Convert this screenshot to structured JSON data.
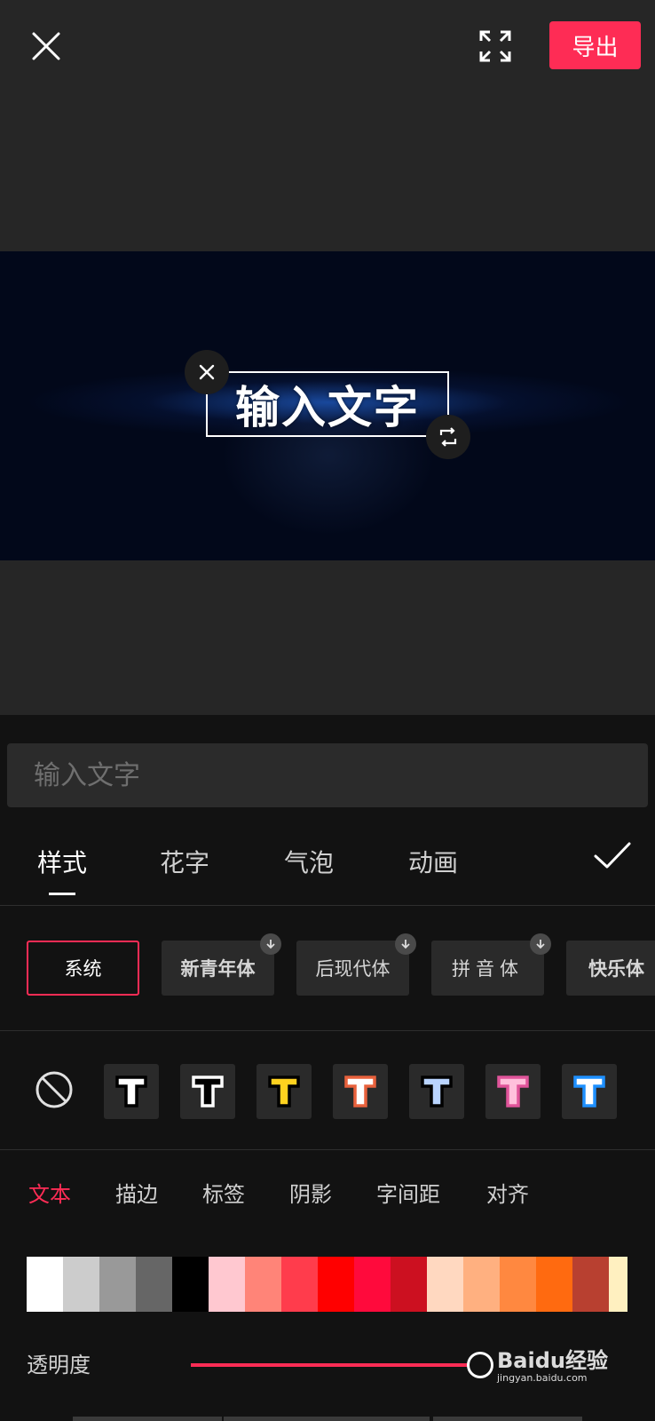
{
  "toolbar": {
    "export_label": "导出"
  },
  "canvas": {
    "overlay_text": "输入文字"
  },
  "editor": {
    "input_placeholder": "输入文字",
    "tabs": [
      {
        "label": "样式",
        "active": true
      },
      {
        "label": "花字",
        "active": false
      },
      {
        "label": "气泡",
        "active": false
      },
      {
        "label": "动画",
        "active": false
      }
    ],
    "fonts": [
      {
        "label": "系统",
        "selected": true,
        "downloadable": false
      },
      {
        "label": "新青年体",
        "selected": false,
        "downloadable": true
      },
      {
        "label": "后现代体",
        "selected": false,
        "downloadable": true
      },
      {
        "label": "拼音体",
        "selected": false,
        "downloadable": true
      },
      {
        "label": "快乐体",
        "selected": false,
        "downloadable": false
      }
    ],
    "presets": [
      {
        "fill": "#ffffff",
        "stroke": "#000000"
      },
      {
        "fill": "#000000",
        "stroke": "#ffffff"
      },
      {
        "fill": "#ffd21f",
        "stroke": "#000000"
      },
      {
        "fill": "#ffffff",
        "stroke": "#e8613c"
      },
      {
        "fill": "#b9d4ff",
        "stroke": "#000000"
      },
      {
        "fill": "#ffc0dc",
        "stroke": "#e0549a"
      },
      {
        "fill": "#ffffff",
        "stroke": "#1e90ff"
      }
    ],
    "subtabs": [
      {
        "label": "文本",
        "active": true
      },
      {
        "label": "描边",
        "active": false
      },
      {
        "label": "标签",
        "active": false
      },
      {
        "label": "阴影",
        "active": false
      },
      {
        "label": "字间距",
        "active": false
      },
      {
        "label": "对齐",
        "active": false
      }
    ],
    "colors": [
      "#ffffff",
      "#cccccc",
      "#999999",
      "#666666",
      "#000000",
      "#ffc8d0",
      "#ff8478",
      "#ff3c4c",
      "#ff0000",
      "#ff0a3c",
      "#cc1020",
      "#ffd8c0",
      "#ffb080",
      "#ff8840",
      "#ff6a10",
      "#b84030",
      "#fff0c0"
    ],
    "opacity_label": "透明度",
    "opacity_value": 0.96
  },
  "watermark": {
    "text": "Baidu经验",
    "subtext": "jingyan.baidu.com"
  },
  "theme": {
    "accent": "#fe2c55"
  }
}
